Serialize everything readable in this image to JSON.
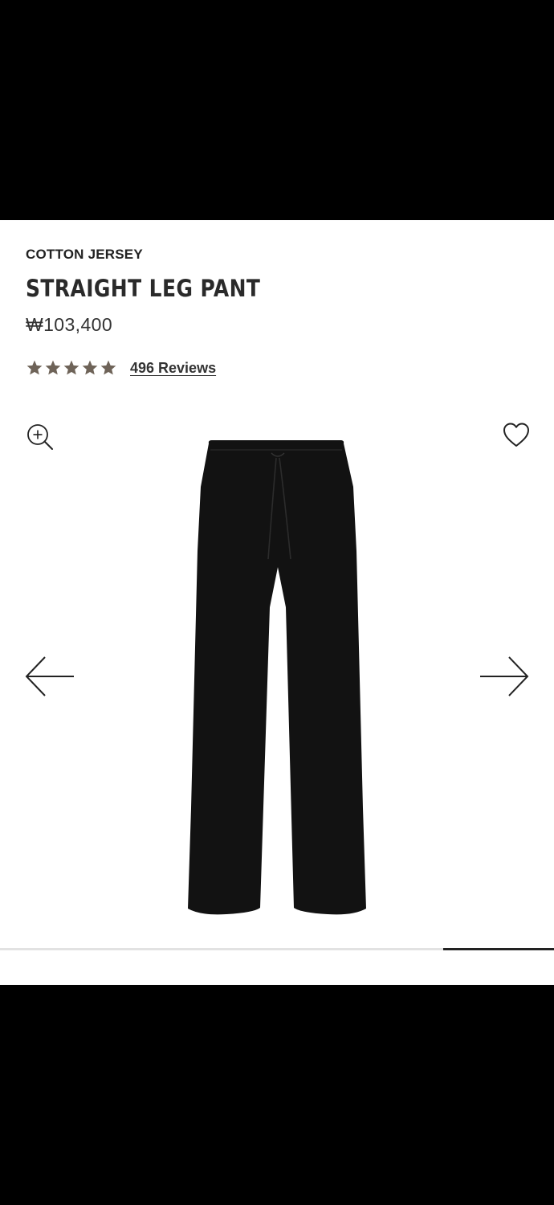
{
  "product": {
    "collection": "COTTON JERSEY",
    "name": "STRAIGHT LEG PANT",
    "price": "₩103,400",
    "rating": {
      "stars": 5,
      "max": 5,
      "color": "#6e6358"
    },
    "reviews_label": "496 Reviews"
  },
  "gallery": {
    "zoom_icon": "zoom-in-icon",
    "wishlist_icon": "heart-icon",
    "prev_icon": "arrow-left-icon",
    "next_icon": "arrow-right-icon",
    "image_color": "#121212",
    "progress": {
      "start": 0.8,
      "end": 1.0
    }
  }
}
